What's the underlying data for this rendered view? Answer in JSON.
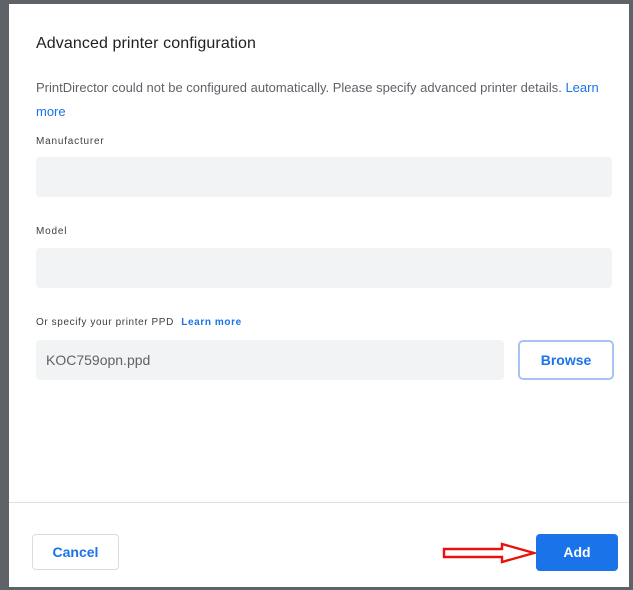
{
  "dialog": {
    "title": "Advanced printer configuration",
    "description": "PrintDirector could not be configured automatically. Please specify advanced printer details.",
    "description_link": "Learn more"
  },
  "fields": {
    "manufacturer": {
      "label": "Manufacturer",
      "value": "",
      "placeholder": ""
    },
    "model": {
      "label": "Model",
      "value": "",
      "placeholder": ""
    },
    "ppd": {
      "label": "Or specify your printer PPD",
      "link": "Learn more",
      "value": "KOC759opn.ppd",
      "browse_label": "Browse"
    }
  },
  "footer": {
    "cancel_label": "Cancel",
    "add_label": "Add"
  },
  "annotation": {
    "arrow_icon": "red-outline-right-arrow",
    "color": "#e8120c"
  },
  "colors": {
    "accent": "#1a73e8",
    "field_bg": "#f1f3f4",
    "text_primary": "#202124",
    "text_secondary": "#5f6368"
  }
}
